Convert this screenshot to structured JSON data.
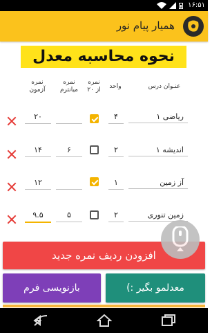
{
  "status_bar": {
    "time": "۱۶:۵۱"
  },
  "app_bar": {
    "title": "همیار پیام نور"
  },
  "main_title": "نحوه محاسبه معدل",
  "columns": {
    "course": "عنـوان درس",
    "unit": "واحد",
    "grade_20": "نمره\nاز ۲۰",
    "midterm": "نمره\nمیانترم",
    "exam": "نمره\nآزمون"
  },
  "rows": [
    {
      "course": "ریاضی ۱",
      "unit": "۴",
      "checked": true,
      "midterm": "",
      "exam": "۲۰"
    },
    {
      "course": "اندیشه ۱",
      "unit": "۲",
      "checked": false,
      "midterm": "۶",
      "exam": "۱۴"
    },
    {
      "course": "آز زمین",
      "unit": "۱",
      "checked": true,
      "midterm": "",
      "exam": "۱۲"
    },
    {
      "course": "زمین تنوری",
      "unit": "۲",
      "checked": false,
      "midterm": "۵",
      "exam": "۹.۵"
    }
  ],
  "buttons": {
    "add_row": "افزودن ردیف نمره جدید",
    "rewrite_form": "بازنویسی فرم",
    "learn_average": "معدلمو بگیر :)"
  },
  "icons": {
    "logo": "hamyar-logo-icon",
    "fab": "scroll-handle-icon",
    "delete": "close-icon",
    "nav_back": "back-icon",
    "nav_home": "home-icon",
    "nav_recents": "recents-icon"
  },
  "colors": {
    "app_bar": "#fbc21c",
    "title_bg": "#ffe21a",
    "add_button": "#f04646",
    "rewrite_button": "#7e3fb8",
    "learn_button": "#1f8f7b",
    "checkbox_checked": "#f4b400",
    "delete": "#e53935"
  }
}
